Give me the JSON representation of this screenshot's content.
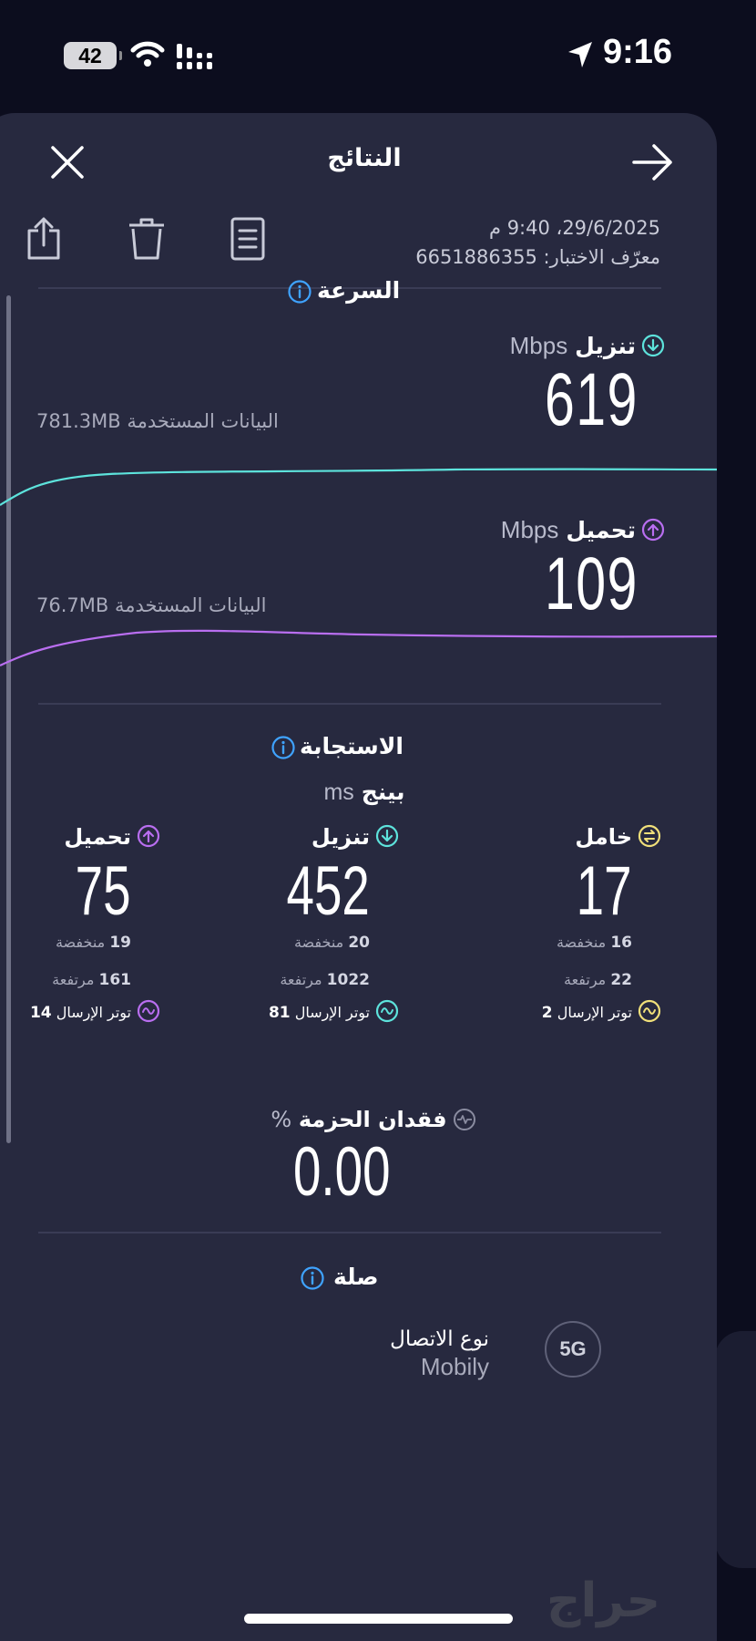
{
  "status_bar": {
    "battery": "42",
    "time": "9:16"
  },
  "header": {
    "title": "النتائج"
  },
  "meta": {
    "date": "29/6/2025، 9:40 م",
    "test_id": "معرّف الاختبار: 6651886355"
  },
  "speed": {
    "title": "السرعة",
    "download": {
      "label": "تنزيل",
      "unit": "Mbps",
      "value": "619",
      "data_used": "البيانات المستخدمة 781.3MB",
      "color": "#5de3dc"
    },
    "upload": {
      "label": "تحميل",
      "unit": "Mbps",
      "value": "109",
      "data_used": "البيانات المستخدمة 76.7MB",
      "color": "#b96ef0"
    }
  },
  "responsiveness": {
    "title": "الاستجابة",
    "ping_label": "بينج",
    "ping_unit": "ms",
    "idle": {
      "label": "خامل",
      "value": "17",
      "low_label": "منخفضة",
      "low_value": "16",
      "high_label": "مرتفعة",
      "high_value": "22",
      "jitter_label": "توتر الإرسال",
      "jitter_value": "2",
      "color": "#f1e07a"
    },
    "download": {
      "label": "تنزيل",
      "value": "452",
      "low_label": "منخفضة",
      "low_value": "20",
      "high_label": "مرتفعة",
      "high_value": "1022",
      "jitter_label": "توتر الإرسال",
      "jitter_value": "81",
      "color": "#5de3dc"
    },
    "upload": {
      "label": "تحميل",
      "value": "75",
      "low_label": "منخفضة",
      "low_value": "19",
      "high_label": "مرتفعة",
      "high_value": "161",
      "jitter_label": "توتر الإرسال",
      "jitter_value": "14",
      "color": "#b96ef0"
    }
  },
  "packet_loss": {
    "label": "فقدان الحزمة",
    "unit": "%",
    "value": "0.00"
  },
  "connection": {
    "title": "صلة",
    "type_label": "نوع الاتصال",
    "type_value": "Mobily",
    "badge": "5G"
  },
  "watermark": "حراج"
}
